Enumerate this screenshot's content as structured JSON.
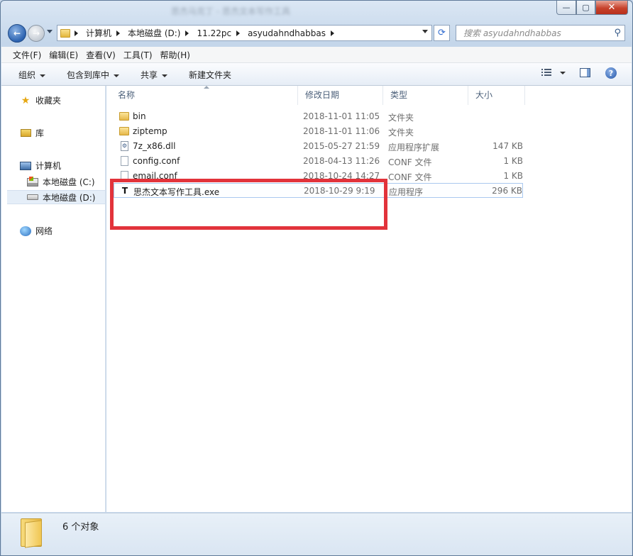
{
  "window": {
    "title": "思杰马克丁 - 思杰文本写作工具",
    "min_label": "—",
    "max_label": "▢",
    "close_label": "✕"
  },
  "address": {
    "crumbs": [
      "计算机",
      "本地磁盘 (D:)",
      "11.22pc",
      "asyudahndhabbas"
    ]
  },
  "search": {
    "placeholder": "搜索 asyudahndhabbas"
  },
  "menu": [
    "文件(F)",
    "编辑(E)",
    "查看(V)",
    "工具(T)",
    "帮助(H)"
  ],
  "toolbar": {
    "organize": "组织",
    "include": "包含到库中",
    "share": "共享",
    "new_folder": "新建文件夹"
  },
  "nav": {
    "favorites": "收藏夹",
    "libraries": "库",
    "computer": "计算机",
    "drive_c": "本地磁盘 (C:)",
    "drive_d": "本地磁盘 (D:)",
    "network": "网络"
  },
  "columns": {
    "name": "名称",
    "date": "修改日期",
    "type": "类型",
    "size": "大小"
  },
  "files": [
    {
      "name": "bin",
      "date": "2018-11-01 11:05",
      "type": "文件夹",
      "size": "",
      "icon": "folder-icon"
    },
    {
      "name": "ziptemp",
      "date": "2018-11-01 11:06",
      "type": "文件夹",
      "size": "",
      "icon": "folder-icon"
    },
    {
      "name": "7z_x86.dll",
      "date": "2015-05-27 21:59",
      "type": "应用程序扩展",
      "size": "147 KB",
      "icon": "dll-icon"
    },
    {
      "name": "config.conf",
      "date": "2018-04-13 11:26",
      "type": "CONF 文件",
      "size": "1 KB",
      "icon": "file-icon"
    },
    {
      "name": "email.conf",
      "date": "2018-10-24 14:27",
      "type": "CONF 文件",
      "size": "1 KB",
      "icon": "file-icon"
    },
    {
      "name": "思杰文本写作工具.exe",
      "date": "2018-10-29 9:19",
      "type": "应用程序",
      "size": "296 KB",
      "icon": "exe-icon"
    }
  ],
  "status": {
    "count": "6 个对象"
  },
  "colors": {
    "highlight_box": "#e2333b",
    "selection_border": "#a9c8ef"
  }
}
